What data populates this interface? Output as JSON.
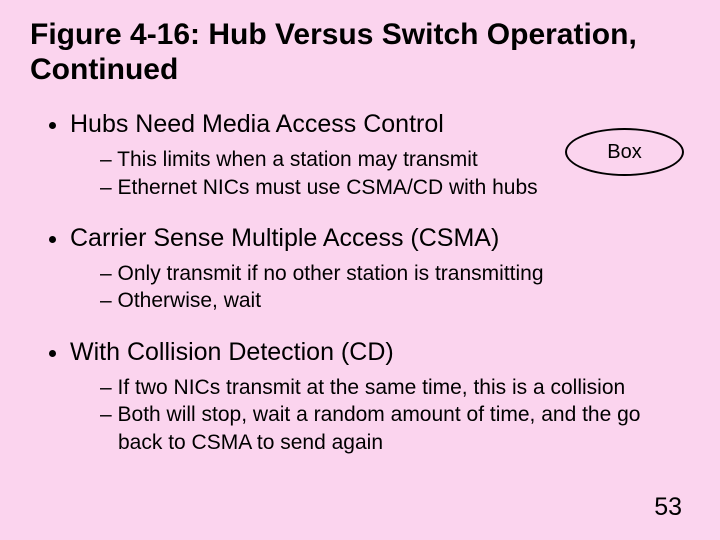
{
  "title": "Figure 4-16: Hub Versus Switch Operation, Continued",
  "callout": "Box",
  "bullets": [
    {
      "text": "Hubs Need Media Access Control",
      "sub": [
        "This limits when a station may transmit",
        "Ethernet NICs must use CSMA/CD with hubs"
      ]
    },
    {
      "text": "Carrier Sense Multiple Access (CSMA)",
      "sub": [
        "Only transmit if no other station is transmitting",
        "Otherwise, wait"
      ]
    },
    {
      "text": "With Collision Detection (CD)",
      "sub": [
        "If two NICs transmit at the same time, this is a collision",
        "Both will stop, wait a random amount of time, and the go back to CSMA to send again"
      ]
    }
  ],
  "pageNumber": "53"
}
